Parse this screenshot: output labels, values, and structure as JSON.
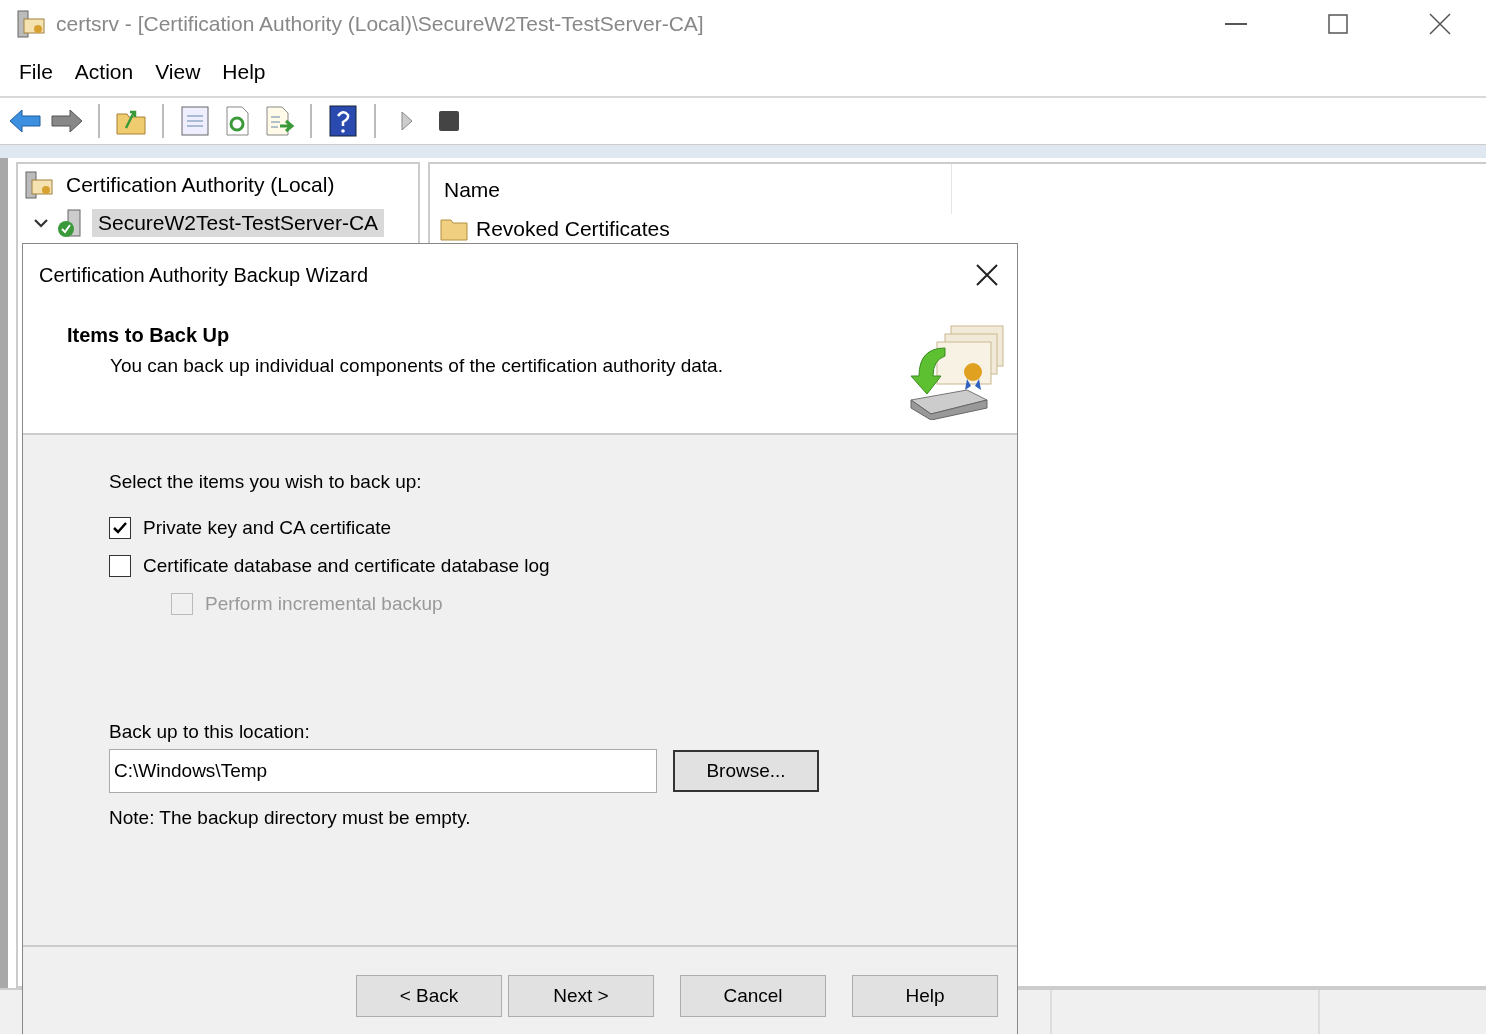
{
  "window": {
    "title": "certsrv - [Certification Authority (Local)\\SecureW2Test-TestServer-CA]"
  },
  "menu": [
    "File",
    "Action",
    "View",
    "Help"
  ],
  "tree": [
    {
      "label": "Certification Authority (Local)",
      "selected": false,
      "children": [
        {
          "label": "SecureW2Test-TestServer-CA",
          "selected": true,
          "expanded": true
        }
      ]
    }
  ],
  "list": {
    "columns": [
      "Name"
    ],
    "rows": [
      "Revoked Certificates"
    ]
  },
  "dialog": {
    "title": "Certification Authority Backup Wizard",
    "heading": "Items to Back Up",
    "subtitle": "You can back up individual components of the certification authority data.",
    "prompt": "Select the items you wish to back up:",
    "options": [
      {
        "label": "Private key and CA certificate",
        "checked": true,
        "disabled": false
      },
      {
        "label": "Certificate database and certificate database log",
        "checked": false,
        "disabled": false,
        "children": [
          {
            "label": "Perform incremental backup",
            "checked": false,
            "disabled": true
          }
        ]
      }
    ],
    "location_label": "Back up to this location:",
    "location": "C:\\Windows\\Temp",
    "browse": "Browse...",
    "note": "Note: The backup directory must be empty.",
    "buttons": [
      "< Back",
      "Next >",
      "Cancel",
      "Help"
    ]
  }
}
